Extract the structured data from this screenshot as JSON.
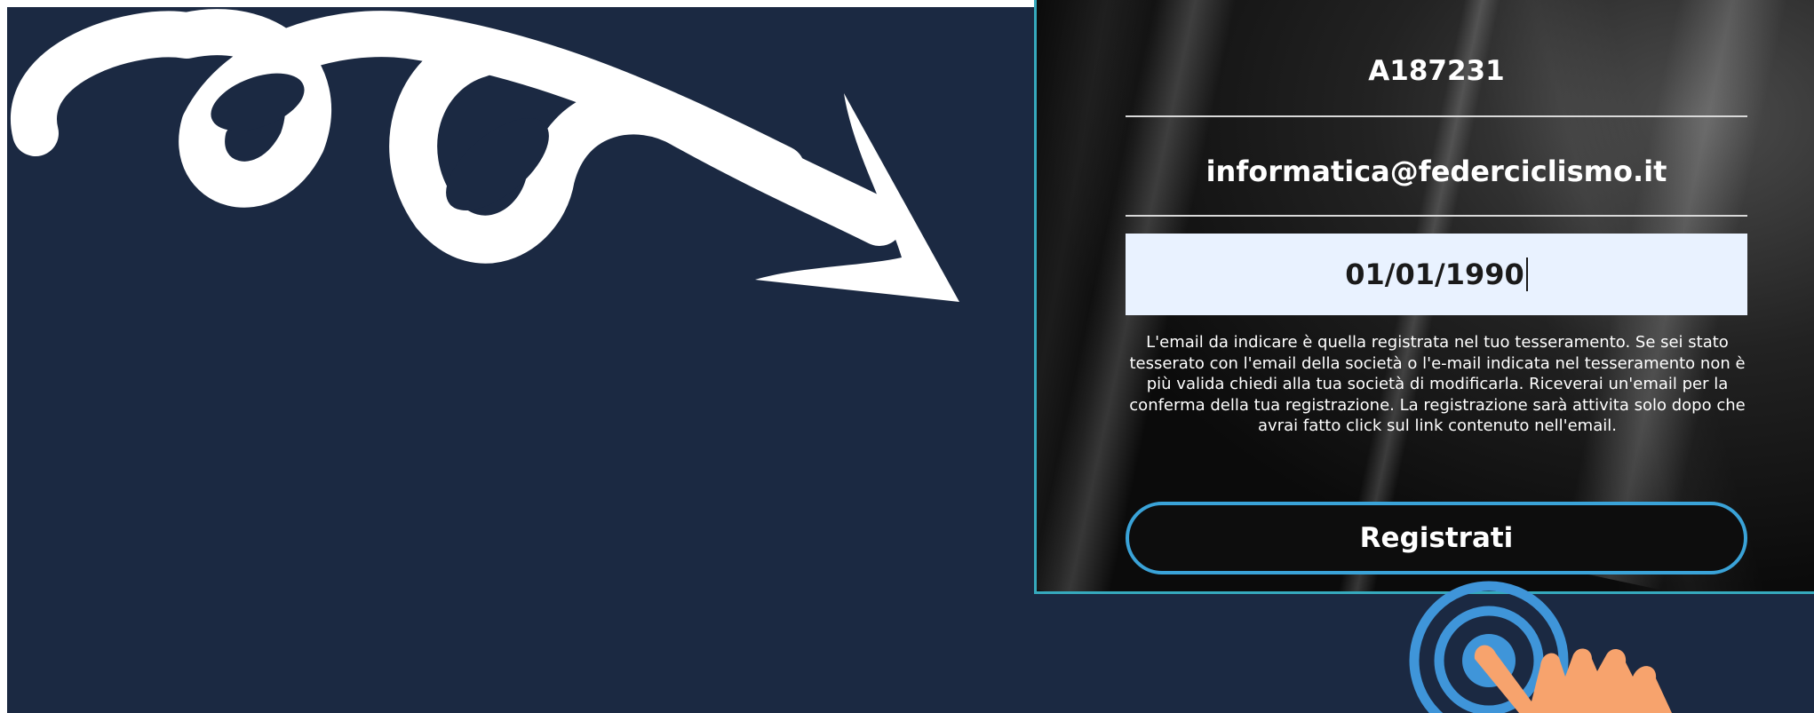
{
  "form": {
    "member_code": "A187231",
    "email": "informatica@federciclismo.it",
    "birth_date": "01/01/1990",
    "info_text": "L'email da indicare è quella registrata nel tuo tesseramento. Se sei stato tesserato con l'email della società o l'e-mail indicata nel tesseramento non è più valida chiedi alla tua società di modificarla. Riceverai un'email per la conferma della tua registrazione. La registrazione sarà attivita solo dopo che avrai fatto click sul link contenuto nell'email.",
    "register_label": "Registrati"
  },
  "colors": {
    "background_navy": "#1b2942",
    "panel_border": "#36a9bd",
    "button_border": "#3aa3d8",
    "input_background": "#e9f2ff",
    "ripple_blue": "#3f95d9",
    "hand_skin": "#f7a36d"
  },
  "icons": {
    "arrow": "curly-arrow-icon",
    "tap": "tap-hand-icon"
  }
}
